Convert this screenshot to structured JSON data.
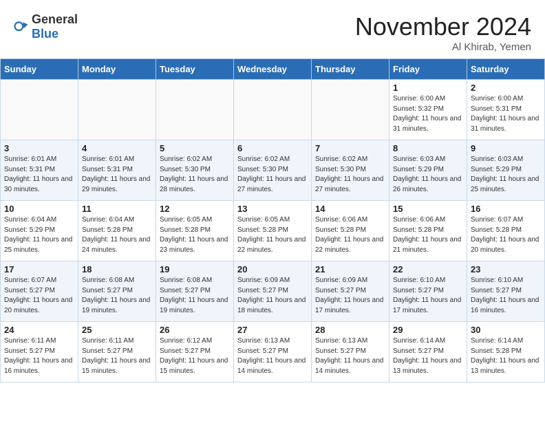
{
  "header": {
    "logo_general": "General",
    "logo_blue": "Blue",
    "month_title": "November 2024",
    "subtitle": "Al Khirab, Yemen"
  },
  "days_of_week": [
    "Sunday",
    "Monday",
    "Tuesday",
    "Wednesday",
    "Thursday",
    "Friday",
    "Saturday"
  ],
  "weeks": [
    [
      {
        "day": "",
        "info": ""
      },
      {
        "day": "",
        "info": ""
      },
      {
        "day": "",
        "info": ""
      },
      {
        "day": "",
        "info": ""
      },
      {
        "day": "",
        "info": ""
      },
      {
        "day": "1",
        "info": "Sunrise: 6:00 AM\nSunset: 5:32 PM\nDaylight: 11 hours and 31 minutes."
      },
      {
        "day": "2",
        "info": "Sunrise: 6:00 AM\nSunset: 5:31 PM\nDaylight: 11 hours and 31 minutes."
      }
    ],
    [
      {
        "day": "3",
        "info": "Sunrise: 6:01 AM\nSunset: 5:31 PM\nDaylight: 11 hours and 30 minutes."
      },
      {
        "day": "4",
        "info": "Sunrise: 6:01 AM\nSunset: 5:31 PM\nDaylight: 11 hours and 29 minutes."
      },
      {
        "day": "5",
        "info": "Sunrise: 6:02 AM\nSunset: 5:30 PM\nDaylight: 11 hours and 28 minutes."
      },
      {
        "day": "6",
        "info": "Sunrise: 6:02 AM\nSunset: 5:30 PM\nDaylight: 11 hours and 27 minutes."
      },
      {
        "day": "7",
        "info": "Sunrise: 6:02 AM\nSunset: 5:30 PM\nDaylight: 11 hours and 27 minutes."
      },
      {
        "day": "8",
        "info": "Sunrise: 6:03 AM\nSunset: 5:29 PM\nDaylight: 11 hours and 26 minutes."
      },
      {
        "day": "9",
        "info": "Sunrise: 6:03 AM\nSunset: 5:29 PM\nDaylight: 11 hours and 25 minutes."
      }
    ],
    [
      {
        "day": "10",
        "info": "Sunrise: 6:04 AM\nSunset: 5:29 PM\nDaylight: 11 hours and 25 minutes."
      },
      {
        "day": "11",
        "info": "Sunrise: 6:04 AM\nSunset: 5:28 PM\nDaylight: 11 hours and 24 minutes."
      },
      {
        "day": "12",
        "info": "Sunrise: 6:05 AM\nSunset: 5:28 PM\nDaylight: 11 hours and 23 minutes."
      },
      {
        "day": "13",
        "info": "Sunrise: 6:05 AM\nSunset: 5:28 PM\nDaylight: 11 hours and 22 minutes."
      },
      {
        "day": "14",
        "info": "Sunrise: 6:06 AM\nSunset: 5:28 PM\nDaylight: 11 hours and 22 minutes."
      },
      {
        "day": "15",
        "info": "Sunrise: 6:06 AM\nSunset: 5:28 PM\nDaylight: 11 hours and 21 minutes."
      },
      {
        "day": "16",
        "info": "Sunrise: 6:07 AM\nSunset: 5:28 PM\nDaylight: 11 hours and 20 minutes."
      }
    ],
    [
      {
        "day": "17",
        "info": "Sunrise: 6:07 AM\nSunset: 5:27 PM\nDaylight: 11 hours and 20 minutes."
      },
      {
        "day": "18",
        "info": "Sunrise: 6:08 AM\nSunset: 5:27 PM\nDaylight: 11 hours and 19 minutes."
      },
      {
        "day": "19",
        "info": "Sunrise: 6:08 AM\nSunset: 5:27 PM\nDaylight: 11 hours and 19 minutes."
      },
      {
        "day": "20",
        "info": "Sunrise: 6:09 AM\nSunset: 5:27 PM\nDaylight: 11 hours and 18 minutes."
      },
      {
        "day": "21",
        "info": "Sunrise: 6:09 AM\nSunset: 5:27 PM\nDaylight: 11 hours and 17 minutes."
      },
      {
        "day": "22",
        "info": "Sunrise: 6:10 AM\nSunset: 5:27 PM\nDaylight: 11 hours and 17 minutes."
      },
      {
        "day": "23",
        "info": "Sunrise: 6:10 AM\nSunset: 5:27 PM\nDaylight: 11 hours and 16 minutes."
      }
    ],
    [
      {
        "day": "24",
        "info": "Sunrise: 6:11 AM\nSunset: 5:27 PM\nDaylight: 11 hours and 16 minutes."
      },
      {
        "day": "25",
        "info": "Sunrise: 6:11 AM\nSunset: 5:27 PM\nDaylight: 11 hours and 15 minutes."
      },
      {
        "day": "26",
        "info": "Sunrise: 6:12 AM\nSunset: 5:27 PM\nDaylight: 11 hours and 15 minutes."
      },
      {
        "day": "27",
        "info": "Sunrise: 6:13 AM\nSunset: 5:27 PM\nDaylight: 11 hours and 14 minutes."
      },
      {
        "day": "28",
        "info": "Sunrise: 6:13 AM\nSunset: 5:27 PM\nDaylight: 11 hours and 14 minutes."
      },
      {
        "day": "29",
        "info": "Sunrise: 6:14 AM\nSunset: 5:27 PM\nDaylight: 11 hours and 13 minutes."
      },
      {
        "day": "30",
        "info": "Sunrise: 6:14 AM\nSunset: 5:28 PM\nDaylight: 11 hours and 13 minutes."
      }
    ]
  ]
}
